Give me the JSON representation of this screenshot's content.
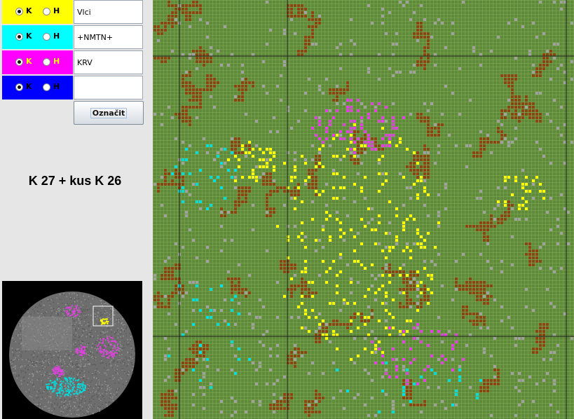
{
  "marker_rows": [
    {
      "color": "#ffff00",
      "label_color": "#000000",
      "options": [
        "K",
        "H"
      ],
      "selected": "K",
      "value": "Vlci"
    },
    {
      "color": "#00ffff",
      "label_color": "#000000",
      "options": [
        "K",
        "H"
      ],
      "selected": "K",
      "value": "+NMTN+"
    },
    {
      "color": "#ff00ff",
      "label_color": "#ffff00",
      "options": [
        "K",
        "H"
      ],
      "selected": "K",
      "value": "KRV"
    },
    {
      "color": "#0000ff",
      "label_color": "#000000",
      "options": [
        "K",
        "H"
      ],
      "selected": "K",
      "value": ""
    }
  ],
  "mark_button_label": "Označit",
  "block_title": "K 27 + kus K 26",
  "colors": {
    "map_background": "#5f8a3a",
    "grid_line": "#83ad5a",
    "brown_trail": "#8b4513",
    "gray_dot": "#a0a0a0",
    "yellow_dot": "#ffff00",
    "cyan_dot": "#00dddd",
    "magenta_dot": "#e040e0",
    "overview_background": "#000000",
    "overview_disc": "#6e6e6e"
  }
}
